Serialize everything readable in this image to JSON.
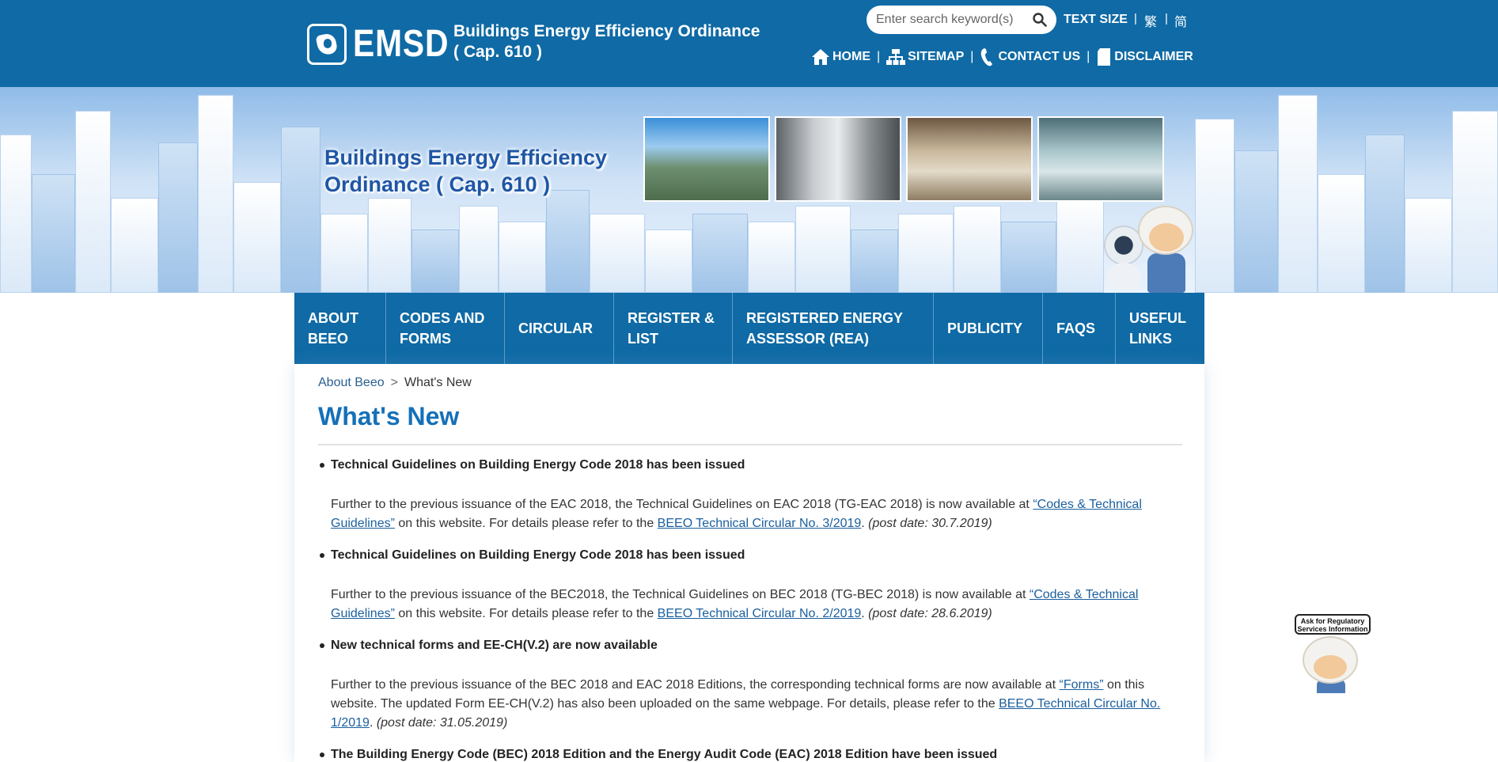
{
  "header": {
    "logo_text": "EMSD",
    "site_title_line1": "Buildings Energy Efficiency Ordinance",
    "site_title_line2": "( Cap. 610 )",
    "search_placeholder": "Enter search keyword(s)",
    "text_size": "TEXT SIZE",
    "lang_traditional": "繁",
    "lang_simplified": "简",
    "links": {
      "home": "HOME",
      "sitemap": "SITEMAP",
      "contact": "CONTACT US",
      "disclaimer": "DISCLAIMER"
    },
    "color": "#0f6aa5"
  },
  "banner": {
    "title_line1": "Buildings Energy Efficiency",
    "title_line2": "Ordinance ( Cap. 610 )"
  },
  "nav": {
    "items": [
      {
        "line1": "ABOUT",
        "line2": "BEEO"
      },
      {
        "line1": "CODES AND",
        "line2": "FORMS"
      },
      {
        "line1": "CIRCULAR",
        "line2": ""
      },
      {
        "line1": "REGISTER &",
        "line2": "LIST"
      },
      {
        "line1": "REGISTERED ENERGY",
        "line2": "ASSESSOR (REA)"
      },
      {
        "line1": "PUBLICITY",
        "line2": ""
      },
      {
        "line1": "FAQS",
        "line2": ""
      },
      {
        "line1": "USEFUL",
        "line2": "LINKS"
      }
    ]
  },
  "breadcrumb": {
    "parent": "About Beeo",
    "separator": ">",
    "current": "What's New"
  },
  "page_title": "What's New",
  "news": [
    {
      "heading": "Technical Guidelines on Building Energy Code 2018 has been issued",
      "text1": "Further to the previous issuance of the EAC 2018, the Technical Guidelines on EAC 2018 (TG-EAC 2018) is now available at ",
      "link1": "“Codes & Technical Guidelines”",
      "text2": " on this website. For details please refer to the ",
      "link2": "BEEO Technical Circular No. 3/2019",
      "text3": ". ",
      "post_date": "(post date: 30.7.2019)"
    },
    {
      "heading": "Technical Guidelines on Building Energy Code 2018 has been issued",
      "text1": "Further to the previous issuance of the BEC2018, the Technical Guidelines on BEC 2018 (TG-BEC 2018) is now available at ",
      "link1": "“Codes & Technical Guidelines”",
      "text2": " on this website. For details please refer to the ",
      "link2": "BEEO Technical Circular No. 2/2019",
      "text3": ". ",
      "post_date": "(post date: 28.6.2019)"
    },
    {
      "heading": "New technical forms and EE-CH(V.2) are now available",
      "text1": "Further to the previous issuance of the BEC 2018 and EAC 2018 Editions, the corresponding technical forms are now available at ",
      "link1": "“Forms”",
      "text2": " on this website. The updated Form EE-CH(V.2) has also been uploaded on the same webpage. For details, please refer to the ",
      "link2": "BEEO Technical Circular No. 1/2019",
      "text3": ". ",
      "post_date": "(post date: 31.05.2019)"
    },
    {
      "heading": "The Building Energy Code (BEC) 2018 Edition and the Energy Audit Code (EAC) 2018 Edition have been issued"
    }
  ],
  "helper": {
    "bubble_line1": "Ask for Regulatory",
    "bubble_line2": "Services Information"
  }
}
